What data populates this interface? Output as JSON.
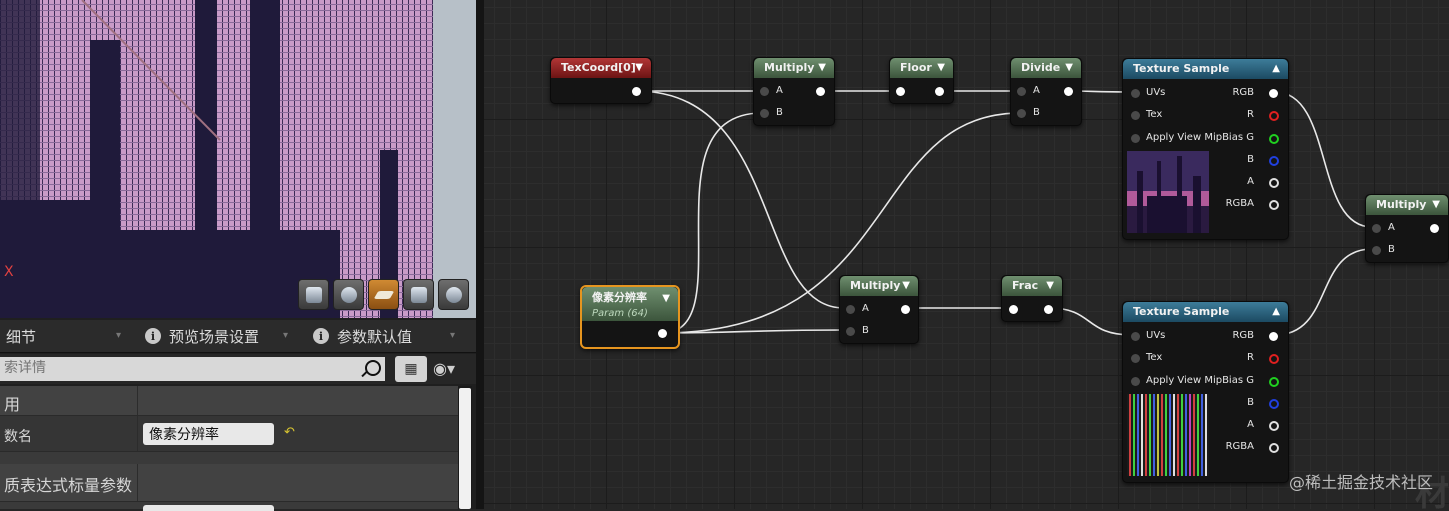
{
  "viewport": {
    "toolbar_buttons": [
      "cylinder-icon",
      "sphere-icon",
      "plane-icon",
      "cube-icon",
      "teapot-icon"
    ],
    "active_button": "plane-icon"
  },
  "details_panel": {
    "tabs": [
      {
        "label": "细节",
        "icon": "details-icon"
      },
      {
        "label": "预览场景设置",
        "icon": "info-icon"
      },
      {
        "label": "参数默认值",
        "icon": "info-icon"
      }
    ],
    "search_placeholder": "搜索详情",
    "search_placeholder_visible": "索详情",
    "grid_icon": "grid-view-icon",
    "eye_icon": "eye-icon",
    "sections": [
      {
        "heading": "用",
        "rows": [
          {
            "label": "数名",
            "value": "像素分辨率"
          }
        ]
      },
      {
        "heading": "质表达式标量参数",
        "rows": []
      }
    ]
  },
  "graph": {
    "nodes": {
      "texcoord": {
        "title": "TexCoord[0]"
      },
      "multiply1": {
        "title": "Multiply",
        "a": "A",
        "b": "B"
      },
      "floor": {
        "title": "Floor"
      },
      "divide": {
        "title": "Divide",
        "a": "A",
        "b": "B"
      },
      "texsample1": {
        "title": "Texture Sample",
        "uvs": "UVs",
        "tex": "Tex",
        "mip": "Apply View MipBias",
        "rgb": "RGB",
        "r": "R",
        "g": "G",
        "b": "B",
        "a": "A",
        "rgba": "RGBA"
      },
      "multiply_out": {
        "title": "Multiply",
        "a": "A",
        "b": "B"
      },
      "param": {
        "title": "像素分辨率",
        "subtitle": "Param (64)"
      },
      "multiply2": {
        "title": "Multiply",
        "a": "A",
        "b": "B"
      },
      "frac": {
        "title": "Frac"
      },
      "texsample2": {
        "title": "Texture Sample",
        "uvs": "UVs",
        "tex": "Tex",
        "mip": "Apply View MipBias",
        "rgb": "RGB",
        "r": "R",
        "g": "G",
        "b": "B",
        "a": "A",
        "rgba": "RGBA"
      }
    }
  },
  "watermark": "@稀土掘金技术社区",
  "watermark_big": "材"
}
